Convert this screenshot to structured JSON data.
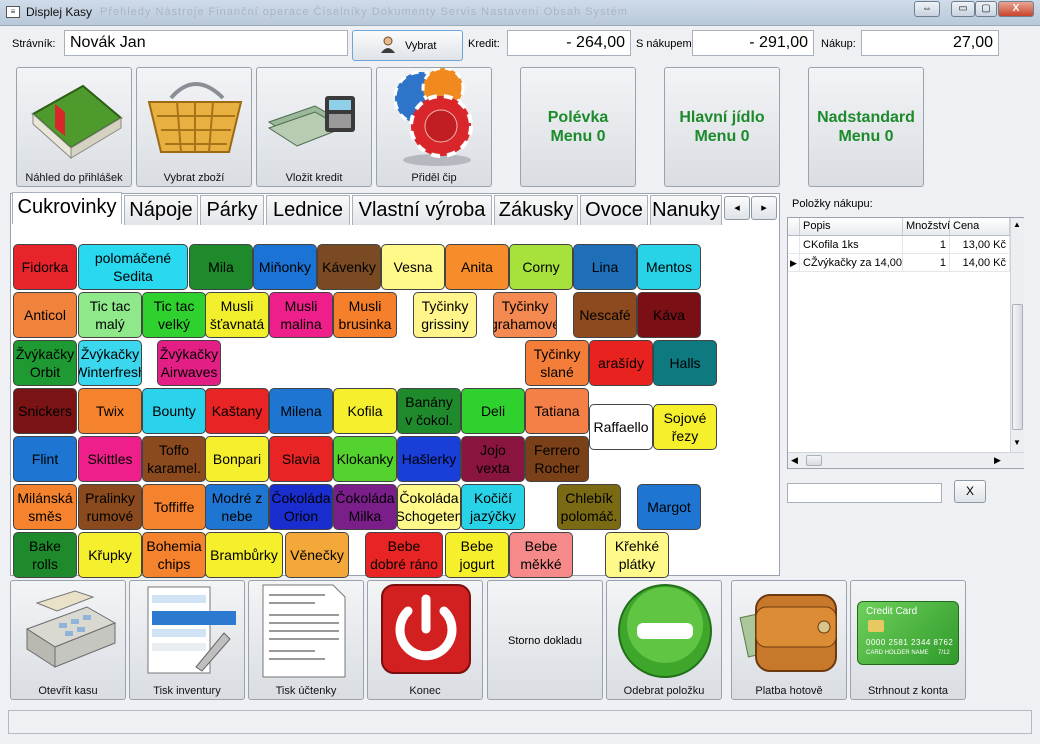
{
  "window": {
    "title": "Displej Kasy",
    "menu_hint": "Přehledy   Nástroje   Finanční operace   Číselníky   Dokumenty   Servis   Nastavení   Obsah   Systém",
    "controls": {
      "restore": "⇔",
      "minimize": "▭",
      "maximize": "▢",
      "close": "X"
    }
  },
  "top": {
    "stravnik_label": "Strávník:",
    "stravnik_value": "Novák Jan",
    "vybrat_label": "Vybrat",
    "kredit_label": "Kredit:",
    "kredit_value": "- 264,00",
    "s_nakupem_label": "S nákupem:",
    "s_nakupem_value": "- 291,00",
    "nakup_label": "Nákup:",
    "nakup_value": "27,00"
  },
  "tiles": {
    "nahled": "Náhled do přihlášek",
    "vybrat_zbozi": "Vybrat zboží",
    "vlozit_kredit": "Vložit kredit",
    "pridel_cip": "Přiděl čip",
    "polevka_1": "Polévka",
    "polevka_2": "Menu 0",
    "hlavni_1": "Hlavní jídlo",
    "hlavni_2": "Menu 0",
    "nadstandard_1": "Nadstandard",
    "nadstandard_2": "Menu 0"
  },
  "tabs": [
    "Cukrovinky",
    "Nápoje",
    "Párky",
    "Lednice",
    "Vlastní výroba",
    "Zákusky",
    "Ovoce",
    "Nanuky"
  ],
  "tab_scroll": {
    "left": "◂",
    "right": "▸"
  },
  "products": [
    {
      "label": "Fidorka",
      "bg": "#e8242b",
      "fg": "#000"
    },
    {
      "label": "polomáčené\nSedita",
      "bg": "#28d9f0",
      "fg": "#000"
    },
    {
      "label": "Mila",
      "bg": "#1f8a2c",
      "fg": "#000"
    },
    {
      "label": "Miňonky",
      "bg": "#1c73d6",
      "fg": "#000"
    },
    {
      "label": "Kávenky",
      "bg": "#7a4a22",
      "fg": "#000"
    },
    {
      "label": "Vesna",
      "bg": "#fff98a",
      "fg": "#000"
    },
    {
      "label": "Anita",
      "bg": "#f78c2a",
      "fg": "#000"
    },
    {
      "label": "Corny",
      "bg": "#a6e23b",
      "fg": "#000"
    },
    {
      "label": "Lina",
      "bg": "#1e6fb8",
      "fg": "#000"
    },
    {
      "label": "Mentos",
      "bg": "#28d3e8",
      "fg": "#000"
    },
    {
      "label": "Anticol",
      "bg": "#f0823c",
      "fg": "#000"
    },
    {
      "label": "Tic tac\nmalý",
      "bg": "#8fe88a",
      "fg": "#000"
    },
    {
      "label": "Tic tac\nvelký",
      "bg": "#2ed12e",
      "fg": "#000"
    },
    {
      "label": "Musli\nšťavnatá",
      "bg": "#f2ef2c",
      "fg": "#000"
    },
    {
      "label": "Musli\nmalina",
      "bg": "#ee1f8a",
      "fg": "#000"
    },
    {
      "label": "Musli\nbrusinka",
      "bg": "#f57f2b",
      "fg": "#000"
    },
    {
      "label": "Tyčinky\ngrissiny",
      "bg": "#fff58a",
      "fg": "#000"
    },
    {
      "label": "Tyčinky\ngrahamové",
      "bg": "#f48a52",
      "fg": "#000"
    },
    {
      "label": "Nescafé",
      "bg": "#8c4a1e",
      "fg": "#000"
    },
    {
      "label": "Káva",
      "bg": "#7a0f16",
      "fg": "#000"
    },
    {
      "label": "Žvýkačky\nOrbit",
      "bg": "#1f9a33",
      "fg": "#000"
    },
    {
      "label": "Žvýkačky\nWinterfresh",
      "bg": "#3ad7ee",
      "fg": "#000"
    },
    {
      "label": "Žvýkačky\nAirwaves",
      "bg": "#e31f86",
      "fg": "#000"
    },
    {
      "label": "Tyčinky\nslané",
      "bg": "#f47d3a",
      "fg": "#000"
    },
    {
      "label": "arašídy",
      "bg": "#e8231f",
      "fg": "#000"
    },
    {
      "label": "Halls",
      "bg": "#0e7a80",
      "fg": "#000"
    },
    {
      "label": "Snickers",
      "bg": "#7a1414",
      "fg": "#000"
    },
    {
      "label": "Twix",
      "bg": "#f5822d",
      "fg": "#000"
    },
    {
      "label": "Bounty",
      "bg": "#2bd2ec",
      "fg": "#000"
    },
    {
      "label": "Kaštany",
      "bg": "#e82424",
      "fg": "#000"
    },
    {
      "label": "Milena",
      "bg": "#1e76d2",
      "fg": "#000"
    },
    {
      "label": "Kofila",
      "bg": "#f5ef2e",
      "fg": "#000"
    },
    {
      "label": "Banány\nv čokol.",
      "bg": "#1f8a2c",
      "fg": "#000"
    },
    {
      "label": "Deli",
      "bg": "#2ed12e",
      "fg": "#000"
    },
    {
      "label": "Tatiana",
      "bg": "#f48048",
      "fg": "#000"
    },
    {
      "label": "Raffaello",
      "bg": "#ffffff",
      "fg": "#000"
    },
    {
      "label": "Sojové\nřezy",
      "bg": "#f6f02c",
      "fg": "#000"
    },
    {
      "label": "Flint",
      "bg": "#1e76d2",
      "fg": "#000"
    },
    {
      "label": "Skittles",
      "bg": "#ee1f8a",
      "fg": "#000"
    },
    {
      "label": "Toffo\nkaramel.",
      "bg": "#8a4a1e",
      "fg": "#000"
    },
    {
      "label": "Bonpari",
      "bg": "#f5ef2e",
      "fg": "#000"
    },
    {
      "label": "Slavia",
      "bg": "#e82424",
      "fg": "#000"
    },
    {
      "label": "Klokanky",
      "bg": "#54d22e",
      "fg": "#000"
    },
    {
      "label": "Hašlerky",
      "bg": "#1a3ed8",
      "fg": "#000"
    },
    {
      "label": "Jojo\nvexta",
      "bg": "#8a1440",
      "fg": "#000"
    },
    {
      "label": "Ferrero\nRocher",
      "bg": "#7a4018",
      "fg": "#000"
    },
    {
      "label": "Milánská\nsměs",
      "bg": "#f5822d",
      "fg": "#000"
    },
    {
      "label": "Pralinky\nrumové",
      "bg": "#8a4a1e",
      "fg": "#000"
    },
    {
      "label": "Toffiffe",
      "bg": "#f5822d",
      "fg": "#000"
    },
    {
      "label": "Modré z\nnebe",
      "bg": "#1e76d2",
      "fg": "#000"
    },
    {
      "label": "Čokoláda\nOrion",
      "bg": "#1a2ed0",
      "fg": "#000"
    },
    {
      "label": "Čokoláda\nMilka",
      "bg": "#7a1e8a",
      "fg": "#000"
    },
    {
      "label": "Čokoláda\nSchogeten",
      "bg": "#fff98a",
      "fg": "#000"
    },
    {
      "label": "Kočičí\njazýčky",
      "bg": "#28d3e8",
      "fg": "#000"
    },
    {
      "label": "Chlebík\npolomáč.",
      "bg": "#7a6a14",
      "fg": "#000"
    },
    {
      "label": "Margot",
      "bg": "#1e76d2",
      "fg": "#000"
    },
    {
      "label": "Bake\nrolls",
      "bg": "#1f8a2c",
      "fg": "#000"
    },
    {
      "label": "Křupky",
      "bg": "#f5ef2e",
      "fg": "#000"
    },
    {
      "label": "Bohemia\nchips",
      "bg": "#f5822d",
      "fg": "#000"
    },
    {
      "label": "Brambůrky",
      "bg": "#f6f02c",
      "fg": "#000"
    },
    {
      "label": "Věnečky",
      "bg": "#f5a83a",
      "fg": "#000"
    },
    {
      "label": "Bebe\ndobré ráno",
      "bg": "#e82424",
      "fg": "#000"
    },
    {
      "label": "Bebe\njogurt",
      "bg": "#f6f02c",
      "fg": "#000"
    },
    {
      "label": "Bebe\nměkké",
      "bg": "#f68a8a",
      "fg": "#000"
    },
    {
      "label": "Křehké\nplátky",
      "bg": "#fff98a",
      "fg": "#000"
    }
  ],
  "items": {
    "label": "Položky nákupu:",
    "columns": [
      "Popis",
      "Množství",
      "Cena"
    ],
    "rows": [
      {
        "popis": "CKofila 1ks",
        "mnozstvi": "1",
        "cena": "13,00 Kč",
        "selected": false
      },
      {
        "popis": "CŽvýkačky za 14,00",
        "mnozstvi": "1",
        "cena": "14,00 Kč",
        "selected": true
      }
    ],
    "row_pointer": "▶",
    "clear_label": "X"
  },
  "bottom": {
    "otevrit_kasu": "Otevřít kasu",
    "tisk_inventury": "Tisk inventury",
    "tisk_uctenky": "Tisk účtenky",
    "konec": "Konec",
    "storno": "Storno dokladu",
    "odebrat": "Odebrat položku",
    "platba": "Platba hotově",
    "strhnout": "Strhnout z konta",
    "card_title": "Credit Card",
    "card_number": "0000 2581 2344 8762",
    "card_holder": "CARD HOLDER NAME",
    "card_date": "7/12"
  },
  "colors": {
    "menu_green": "#1d8a2b",
    "accent": "#3f8fd8"
  }
}
